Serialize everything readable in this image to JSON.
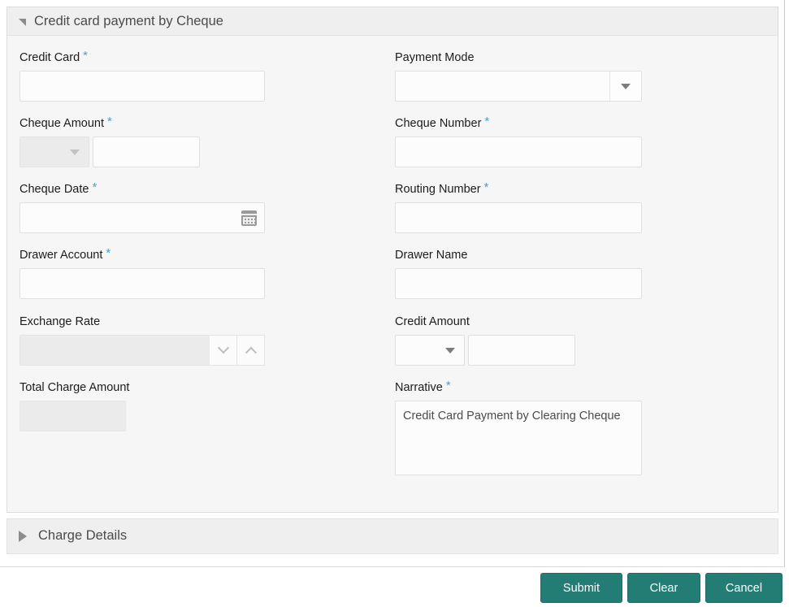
{
  "panel": {
    "title": "Credit card payment by Cheque",
    "collapse_icon": "triangle-expanded-icon",
    "expanded": true
  },
  "fields": {
    "credit_card": {
      "label": "Credit Card",
      "required": "*",
      "value": "",
      "type": "text"
    },
    "payment_mode": {
      "label": "Payment Mode",
      "required": "",
      "value": "",
      "type": "select",
      "icon": "chevron-down-icon"
    },
    "cheque_amount": {
      "label": "Cheque Amount",
      "required": "*",
      "currency": "",
      "value": "",
      "type": "amount",
      "currency_disabled": true
    },
    "cheque_number": {
      "label": "Cheque Number",
      "required": "*",
      "value": "",
      "type": "text"
    },
    "cheque_date": {
      "label": "Cheque Date",
      "required": "*",
      "value": "",
      "type": "date",
      "icon": "calendar-icon"
    },
    "routing_number": {
      "label": "Routing Number",
      "required": "*",
      "value": "",
      "type": "text"
    },
    "drawer_account": {
      "label": "Drawer Account",
      "required": "*",
      "value": "",
      "type": "text"
    },
    "drawer_name": {
      "label": "Drawer Name",
      "required": "",
      "value": "",
      "type": "text"
    },
    "exchange_rate": {
      "label": "Exchange Rate",
      "required": "",
      "value": "",
      "type": "stepper",
      "disabled": true,
      "icon_down": "chevron-down-icon",
      "icon_up": "chevron-up-icon"
    },
    "credit_amount": {
      "label": "Credit Amount",
      "required": "",
      "currency": "",
      "value": "",
      "type": "amount",
      "currency_disabled": false
    },
    "total_charge_amount": {
      "label": "Total Charge Amount",
      "required": "",
      "value": "",
      "type": "readonly",
      "disabled": true
    },
    "narrative": {
      "label": "Narrative",
      "required": "*",
      "value": "Credit Card Payment by Clearing Cheque",
      "type": "textarea"
    }
  },
  "charge_details": {
    "title": "Charge Details",
    "collapse_icon": "triangle-collapsed-icon",
    "expanded": false
  },
  "footer": {
    "submit_label": "Submit",
    "clear_label": "Clear",
    "cancel_label": "Cancel"
  },
  "colors": {
    "button_teal": "#247d74",
    "required_asterisk": "#4a9fd8",
    "panel_background": "#f6f6f6",
    "header_background": "#efefef"
  }
}
